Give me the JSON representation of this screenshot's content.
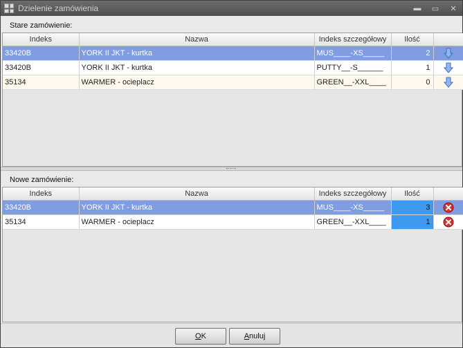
{
  "window": {
    "title": "Dzielenie zamówienia",
    "minimize_glyph": "▬",
    "restore_glyph": "▭",
    "close_glyph": "✕"
  },
  "old_order": {
    "label": "Stare zamówienie:",
    "columns": [
      "Indeks",
      "Nazwa",
      "Indeks szczegółowy",
      "Ilość",
      ""
    ],
    "rows": [
      {
        "indeks": "33420B",
        "nazwa": "YORK II JKT - kurtka",
        "szczegolowy": "MUS____-XS_____",
        "ilosc": "2",
        "selected": true
      },
      {
        "indeks": "33420B",
        "nazwa": "YORK II JKT - kurtka",
        "szczegolowy": "PUTTY__-S______",
        "ilosc": "1",
        "selected": false
      },
      {
        "indeks": "35134",
        "nazwa": "WARMER - ocieplacz",
        "szczegolowy": "GREEN__-XXL____",
        "ilosc": "0",
        "selected": false
      }
    ]
  },
  "new_order": {
    "label": "Nowe zamówienie:",
    "columns": [
      "Indeks",
      "Nazwa",
      "Indeks szczegółowy",
      "Ilość",
      ""
    ],
    "rows": [
      {
        "indeks": "33420B",
        "nazwa": "YORK II JKT - kurtka",
        "szczegolowy": "MUS____-XS_____",
        "ilosc": "3",
        "selected": true
      },
      {
        "indeks": "35134",
        "nazwa": "WARMER - ocieplacz",
        "szczegolowy": "GREEN__-XXL____",
        "ilosc": "1",
        "selected": false
      }
    ]
  },
  "buttons": {
    "ok_first": "O",
    "ok_rest": "K",
    "cancel_first": "A",
    "cancel_rest": "nuluj"
  },
  "colors": {
    "selection": "#7f9de0",
    "qty_edit": "#3d9af0",
    "arrow": "#5b8fd6",
    "delete": "#d93030"
  }
}
